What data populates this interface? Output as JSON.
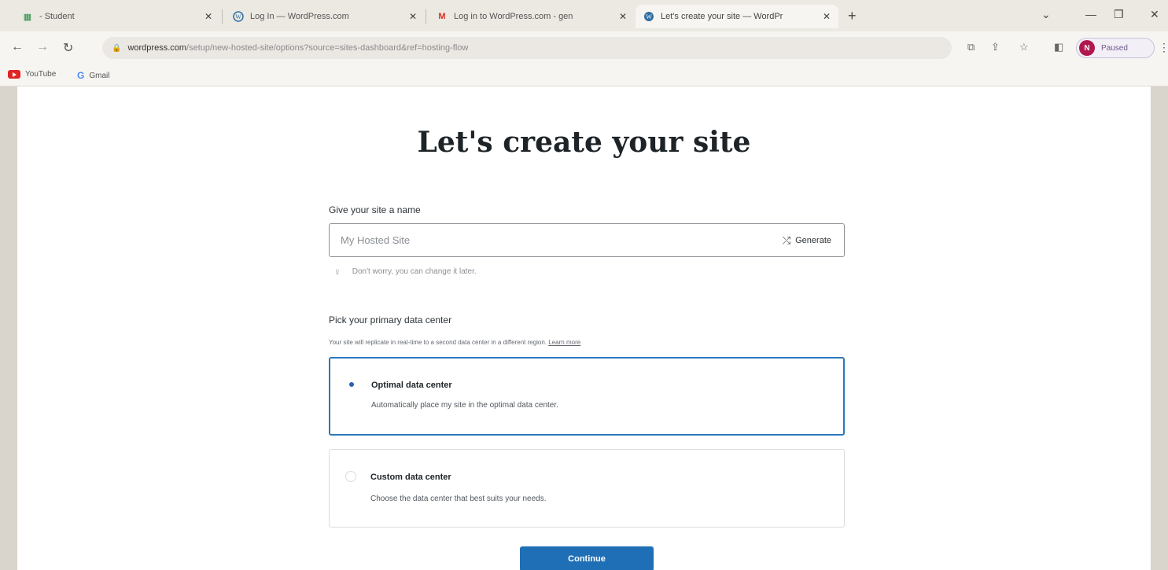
{
  "browser": {
    "tabs": [
      {
        "title": "- Student",
        "icon": "sheets-icon",
        "active": false
      },
      {
        "title": "Log In — WordPress.com",
        "icon": "wordpress-icon",
        "active": false
      },
      {
        "title": "Log in to WordPress.com - gen",
        "icon": "gmail-icon",
        "active": false
      },
      {
        "title": "Let's create your site — WordPr",
        "icon": "wordpress-icon",
        "active": true
      }
    ],
    "url_host": "wordpress.com",
    "url_path": "/setup/new-hosted-site/options?source=sites-dashboard&ref=hosting-flow",
    "profile": {
      "initial": "N",
      "status": "Paused"
    },
    "bookmarks": [
      {
        "label": "YouTube",
        "icon": "youtube-icon"
      },
      {
        "label": "Gmail",
        "icon": "google-icon"
      }
    ]
  },
  "page": {
    "title": "Let's create your site",
    "site_name": {
      "label": "Give your site a name",
      "placeholder": "My Hosted Site",
      "generate_label": "Generate",
      "hint": "Don't worry, you can change it later."
    },
    "data_center": {
      "label": "Pick your primary data center",
      "subtitle": "Your site will replicate in real-time to a second data center in a different region.",
      "learn_more": "Learn more",
      "options": [
        {
          "title": "Optimal data center",
          "description": "Automatically place my site in the optimal data center.",
          "selected": true
        },
        {
          "title": "Custom data center",
          "description": "Choose the data center that best suits your needs.",
          "selected": false
        }
      ]
    },
    "continue_label": "Continue"
  },
  "colors": {
    "accent": "#2b78bd",
    "button": "#1f6fb6"
  }
}
